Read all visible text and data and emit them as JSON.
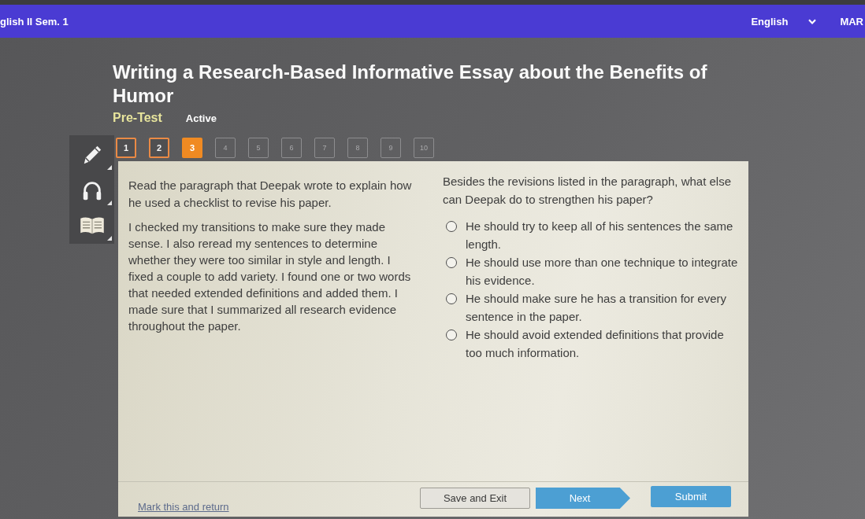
{
  "header": {
    "course": "glish II Sem. 1",
    "language": "English",
    "user": "MAR"
  },
  "activity": {
    "title": "Writing a Research-Based Informative Essay about the Benefits of Humor",
    "type": "Pre-Test",
    "status": "Active"
  },
  "question_nav": [
    {
      "label": "1",
      "visited": true,
      "selected": false
    },
    {
      "label": "2",
      "visited": true,
      "selected": false
    },
    {
      "label": "3",
      "visited": true,
      "selected": true
    },
    {
      "label": "4",
      "visited": false,
      "selected": false
    },
    {
      "label": "5",
      "visited": false,
      "selected": false
    },
    {
      "label": "6",
      "visited": false,
      "selected": false
    },
    {
      "label": "7",
      "visited": false,
      "selected": false
    },
    {
      "label": "8",
      "visited": false,
      "selected": false
    },
    {
      "label": "9",
      "visited": false,
      "selected": false
    },
    {
      "label": "10",
      "visited": false,
      "selected": false
    }
  ],
  "passage": {
    "instruction": "Read the paragraph that Deepak wrote to explain how he used a checklist to revise his paper.",
    "text": "I checked my transitions to make sure they made sense. I also reread my sentences to determine whether they were too similar in style and length. I fixed a couple to add variety. I found one or two words that needed extended definitions and added them. I made sure that I summarized all research evidence throughout the paper."
  },
  "question": {
    "prompt": "Besides the revisions listed in the paragraph, what else can Deepak do to strengthen his paper?",
    "options": [
      {
        "text": "He should try to keep all of his sentences the same length.",
        "selected": false
      },
      {
        "text": "He should use more than one technique to integrate his evidence.",
        "selected": false
      },
      {
        "text": "He should make sure he has a transition for every sentence in the paper.",
        "selected": false
      },
      {
        "text": "He should avoid extended definitions that provide too much information.",
        "selected": false
      }
    ]
  },
  "footer": {
    "mark_link": "Mark this and return",
    "buttons": [
      {
        "label": "Save and Exit",
        "kind": "secondary"
      },
      {
        "label": "Next",
        "kind": "next"
      },
      {
        "label": "Submit",
        "kind": "primary"
      }
    ]
  }
}
